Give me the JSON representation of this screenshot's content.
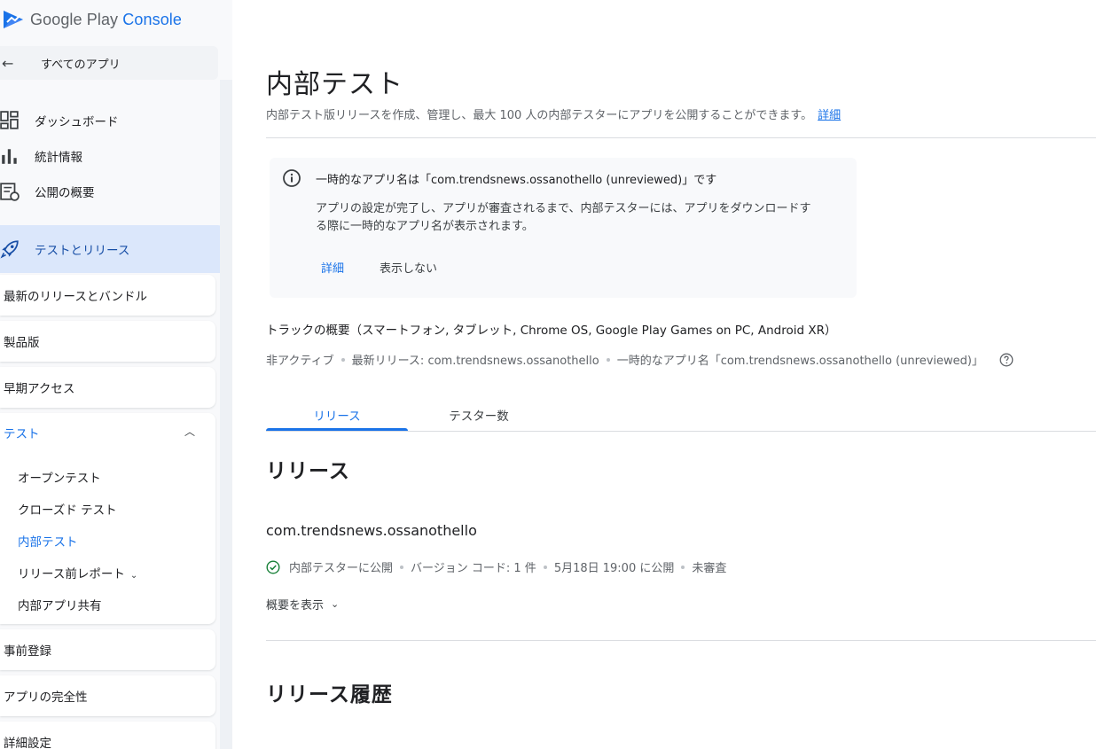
{
  "brand": {
    "google_play": "Google Play",
    "console": "Console"
  },
  "sidebar": {
    "back_label": "すべてのアプリ",
    "items": [
      {
        "label": "ダッシュボード",
        "icon": "dashboard-icon"
      },
      {
        "label": "統計情報",
        "icon": "bar-chart-icon"
      },
      {
        "label": "公開の概要",
        "icon": "publishing-overview-icon"
      }
    ],
    "section": {
      "label": "テストとリリース",
      "icon": "rocket-icon"
    },
    "sub_items": [
      "最新のリリースとバンドル",
      "製品版",
      "早期アクセス"
    ],
    "test_group": {
      "label": "テスト",
      "links": [
        "オープンテスト",
        "クローズド テスト",
        "内部テスト",
        "リリース前レポート",
        "内部アプリ共有"
      ],
      "active": "内部テスト"
    },
    "bottom_items": [
      "事前登録",
      "アプリの完全性",
      "詳細設定"
    ]
  },
  "main": {
    "title": "内部テスト",
    "description": "内部テスト版リリースを作成、管理し、最大 100 人の内部テスターにアプリを公開することができます。",
    "description_link": "詳細",
    "info": {
      "title": "一時的なアプリ名は「com.trendsnews.ossanothello (unreviewed)」です",
      "body": "アプリの設定が完了し、アプリが審査されるまで、内部テスターには、アプリをダウンロードする際に一時的なアプリ名が表示されます。",
      "primary": "詳細",
      "secondary": "表示しない"
    },
    "track": {
      "title": "トラックの概要（スマートフォン, タブレット, Chrome OS, Google Play Games on PC, Android XR）",
      "status": "非アクティブ",
      "latest": "最新リリース: com.trendsnews.ossanothello",
      "temp_name": "一時的なアプリ名「com.trendsnews.ossanothello (unreviewed)」"
    },
    "tabs": [
      {
        "label": "リリース"
      },
      {
        "label": "テスター数"
      }
    ],
    "releases_heading": "リリース",
    "release": {
      "name": "com.trendsnews.ossanothello",
      "status": "内部テスターに公開",
      "version": "バージョン コード: 1 件",
      "published": "5月18日 19:00 に公開",
      "review": "未審査",
      "summary": "概要を表示"
    },
    "history_heading": "リリース履歴"
  },
  "colors": {
    "accent": "#1a73e8",
    "selected_bg": "#dbe7fb",
    "success": "#188038"
  }
}
